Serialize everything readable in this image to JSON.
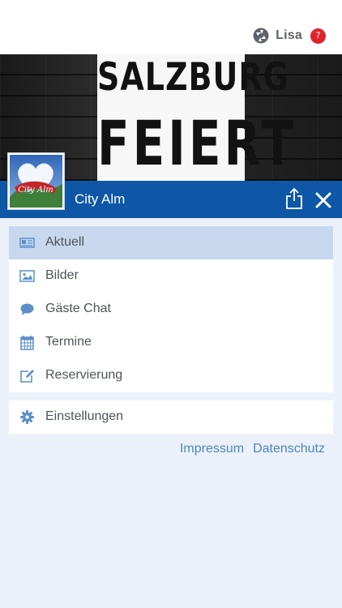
{
  "header": {
    "user_name": "Lisa",
    "notification_count": "7"
  },
  "banner": {
    "line1": "SALZBURG",
    "line2": "FEIERT"
  },
  "venue": {
    "name": "City Alm",
    "avatar_text": "City Alm"
  },
  "menu": {
    "items": [
      {
        "label": "Aktuell",
        "icon": "newspaper-icon",
        "active": true
      },
      {
        "label": "Bilder",
        "icon": "image-icon",
        "active": false
      },
      {
        "label": "Gäste Chat",
        "icon": "chat-bubble-icon",
        "active": false
      },
      {
        "label": "Termine",
        "icon": "calendar-icon",
        "active": false
      },
      {
        "label": "Reservierung",
        "icon": "edit-icon",
        "active": false
      }
    ],
    "settings_label": "Einstellungen"
  },
  "footer": {
    "impressum": "Impressum",
    "datenschutz": "Datenschutz"
  },
  "colors": {
    "title_bar": "#0e57a7",
    "active_item": "#c7d8ee",
    "icon": "#5b8fc7",
    "link": "#4c86c1",
    "badge": "#e0242a",
    "background": "#ecf1f9"
  }
}
